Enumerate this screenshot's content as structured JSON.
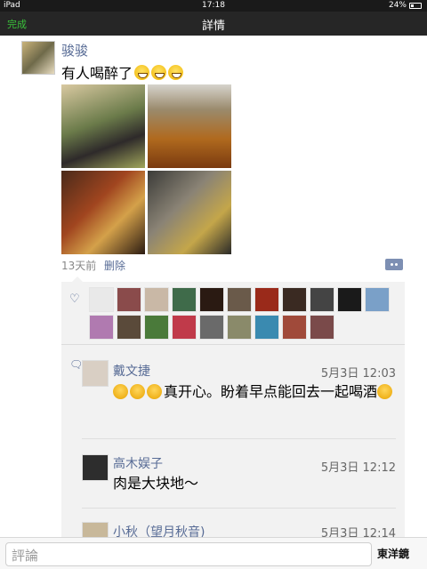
{
  "status_bar": {
    "device": "iPad",
    "time": "17:18",
    "battery": "24%"
  },
  "nav": {
    "done": "完成",
    "title": "詳情"
  },
  "post": {
    "author": "骏骏",
    "text": "有人喝醉了",
    "emoji_count": 3,
    "time": "13天前",
    "delete": "删除"
  },
  "likes": {
    "avatar_colors": [
      "#e9e9e9",
      "#8a4b4b",
      "#c9b8a6",
      "#3f6b4a",
      "#2a1a12",
      "#6a5a4a",
      "#9a2a1a",
      "#3a2a22",
      "#444444",
      "#1a1a1a",
      "#7aa0c8",
      "#b07ab0",
      "#5a4a3a",
      "#4a7a3a",
      "#c03a4a",
      "#6a6a6a",
      "#8a8a6a",
      "#3a8ab0",
      "#a04a3a",
      "#7a4a4a"
    ]
  },
  "comments": [
    {
      "name": "戴文捷",
      "time": "5月3日 12:03",
      "text": "真开心。盼着早点能回去一起喝酒",
      "avatar": "#d9cfc4"
    },
    {
      "name": "高木娱子",
      "time": "5月3日 12:12",
      "text": "肉是大块地～",
      "avatar": "#2d2d2d"
    },
    {
      "name": "小秋（望月秋音)",
      "time": "5月3日 12:14",
      "text": "",
      "avatar": "#c8b89a"
    }
  ],
  "input": {
    "placeholder": "評論"
  },
  "watermark": "東洋鏡"
}
